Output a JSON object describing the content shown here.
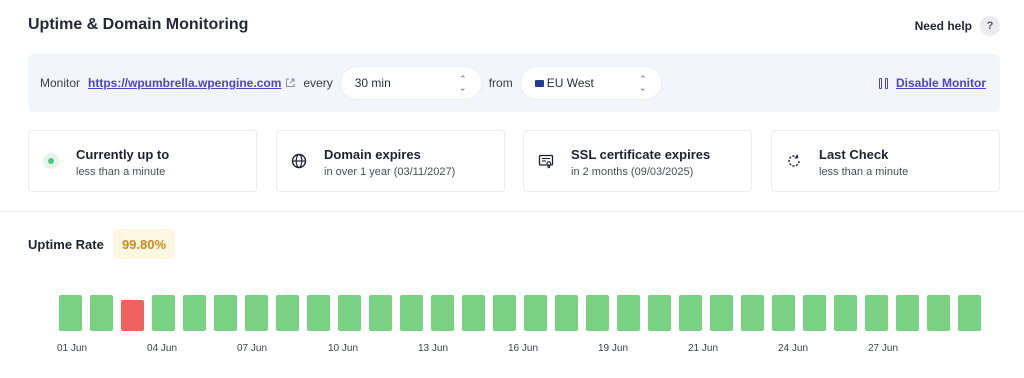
{
  "header": {
    "title": "Uptime & Domain Monitoring",
    "help_label": "Need help",
    "help_icon": "?"
  },
  "monitor": {
    "label": "Monitor",
    "url": "https://wpumbrella.wpengine.com",
    "every_label": "every",
    "interval": "30 min",
    "from_label": "from",
    "region": "EU West",
    "disable_label": "Disable Monitor"
  },
  "cards": [
    {
      "title": "Currently up to",
      "sub": "less than a minute",
      "icon": "status-dot-icon"
    },
    {
      "title": "Domain expires",
      "sub": "in over 1 year (03/11/2027)",
      "icon": "globe-icon"
    },
    {
      "title": "SSL certificate expires",
      "sub": "in 2 months (09/03/2025)",
      "icon": "certificate-icon"
    },
    {
      "title": "Last Check",
      "sub": "less than a minute",
      "icon": "refresh-icon"
    }
  ],
  "uptime": {
    "title": "Uptime Rate",
    "rate": "99.80%",
    "colors": {
      "up": "#79d184",
      "down": "#ee6360"
    },
    "status": [
      "up",
      "up",
      "down",
      "up",
      "up",
      "up",
      "up",
      "up",
      "up",
      "up",
      "up",
      "up",
      "up",
      "up",
      "up",
      "up",
      "up",
      "up",
      "up",
      "up",
      "up",
      "up",
      "up",
      "up",
      "up",
      "up",
      "up",
      "up",
      "up",
      "up"
    ],
    "labels": [
      "01 Jun",
      "04 Jun",
      "07 Jun",
      "10 Jun",
      "13 Jun",
      "16 Jun",
      "19 Jun",
      "21 Jun",
      "24 Jun",
      "27 Jun"
    ]
  }
}
